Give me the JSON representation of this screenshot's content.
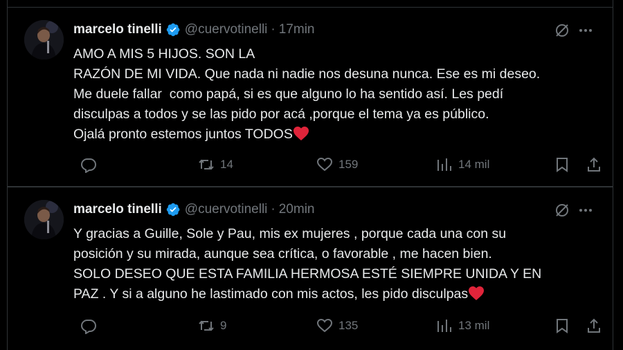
{
  "tweets": [
    {
      "author": {
        "name": "marcelo tinelli",
        "handle": "@cuervotinelli",
        "separator": "·",
        "time": "17min"
      },
      "lines": [
        "AMO A MIS 5 HIJOS. SON LA",
        "RAZÓN DE MI VIDA. Que nada ni nadie nos desuna nunca. Ese es mi deseo.",
        "Me duele fallar  como papá, si es que alguno lo ha sentido así. Les pedí",
        "disculpas a todos y se las pido por acá ,porque el tema ya es público.",
        "Ojalá pronto estemos juntos TODOS"
      ],
      "stats": {
        "retweets": "14",
        "likes": "159",
        "views": "14 mil"
      }
    },
    {
      "author": {
        "name": "marcelo tinelli",
        "handle": "@cuervotinelli",
        "separator": "·",
        "time": "20min"
      },
      "lines": [
        "Y gracias a Guille, Sole y Pau, mis ex mujeres , porque cada una con su",
        "posición y su mirada, aunque sea crítica, o favorable , me hacen bien.",
        "SOLO DESEO QUE ESTA FAMILIA HERMOSA ESTÉ SIEMPRE UNIDA Y EN",
        "PAZ . Y si a alguno he lastimado con mis actos, les pido disculpas"
      ],
      "stats": {
        "retweets": "9",
        "likes": "135",
        "views": "13 mil"
      }
    }
  ],
  "icons": {
    "verified": "verified-badge-icon",
    "grok": "grok-icon",
    "more": "more-icon",
    "reply": "reply-icon",
    "retweet": "retweet-icon",
    "like": "like-icon",
    "views": "views-icon",
    "bookmark": "bookmark-icon",
    "share": "share-icon",
    "emoji": "red-heart-emoji"
  },
  "colors": {
    "background": "#000000",
    "text": "#e7e9ea",
    "muted": "#71767b",
    "verified": "#1d9bf0",
    "heart": "#f4212e"
  }
}
